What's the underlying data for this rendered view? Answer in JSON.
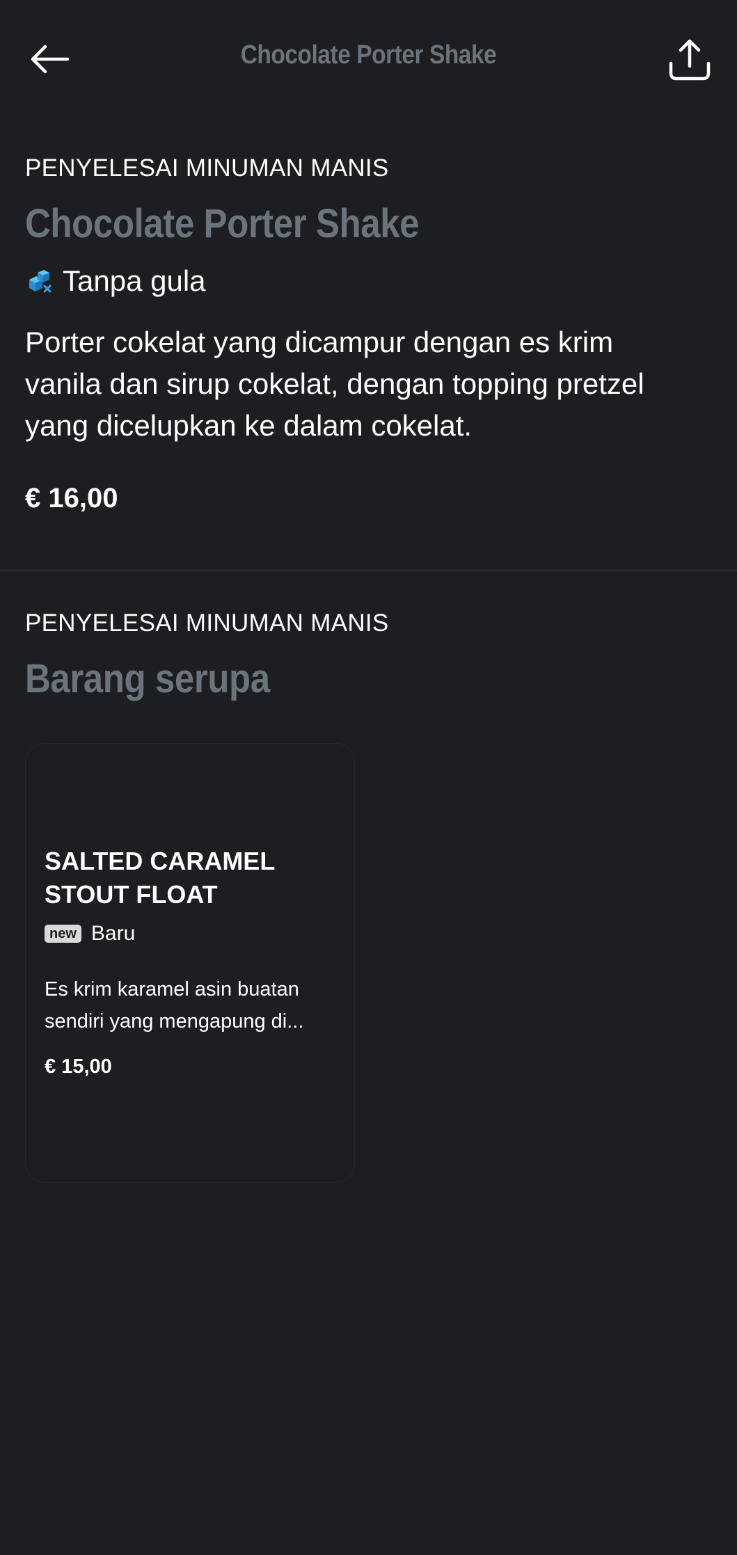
{
  "header": {
    "title": "Chocolate Porter Shake",
    "back_icon": "arrow-left-icon",
    "share_icon": "share-icon"
  },
  "product": {
    "category": "PENYELESAI MINUMAN MANIS",
    "name": "Chocolate Porter Shake",
    "tag_icon": "sugar-free-icon",
    "tag": "Tanpa gula",
    "description_lines": [
      "Porter cokelat yang dicampur dengan es krim",
      "vanila dan sirup cokelat, dengan topping pretzel",
      "yang dicelupkan ke dalam cokelat."
    ],
    "price": "€ 16,00"
  },
  "similar": {
    "category": "PENYELESAI MINUMAN MANIS",
    "heading": "Barang serupa",
    "items": [
      {
        "title_lines": [
          "SALTED CARAMEL",
          "STOUT FLOAT"
        ],
        "badge": "new",
        "tag": "Baru",
        "description_lines": [
          "Es krim karamel asin buatan",
          "sendiri yang mengapung di..."
        ],
        "price": "€ 15,00"
      }
    ]
  },
  "colors": {
    "background": "#1d1e22",
    "muted_heading": "#6b737b",
    "text": "#ffffff",
    "accent_icon": "#2fa8e0"
  }
}
